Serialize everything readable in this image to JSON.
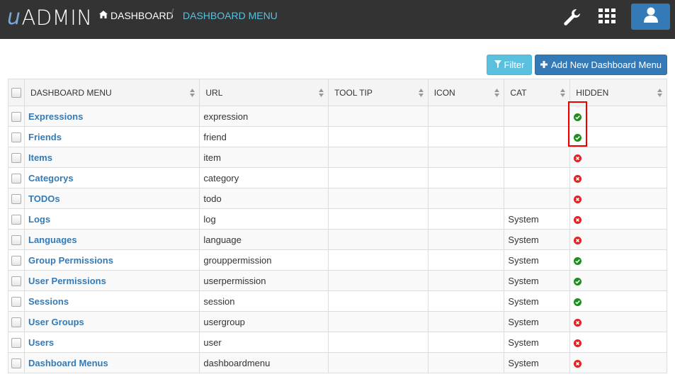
{
  "brand": {
    "prefix": "u",
    "name": "ADMIN"
  },
  "breadcrumb": {
    "home": "DASHBOARD",
    "separator": "/",
    "current": "DASHBOARD MENU"
  },
  "toolbar": {
    "filter_label": "Filter",
    "add_label": "Add New Dashboard Menu"
  },
  "table": {
    "columns": [
      "DASHBOARD MENU",
      "URL",
      "TOOL TIP",
      "ICON",
      "CAT",
      "HIDDEN"
    ],
    "rows": [
      {
        "name": "Expressions",
        "url": "expression",
        "tooltip": "",
        "icon": "",
        "cat": "",
        "hidden": true
      },
      {
        "name": "Friends",
        "url": "friend",
        "tooltip": "",
        "icon": "",
        "cat": "",
        "hidden": true
      },
      {
        "name": "Items",
        "url": "item",
        "tooltip": "",
        "icon": "",
        "cat": "",
        "hidden": false
      },
      {
        "name": "Categorys",
        "url": "category",
        "tooltip": "",
        "icon": "",
        "cat": "",
        "hidden": false
      },
      {
        "name": "TODOs",
        "url": "todo",
        "tooltip": "",
        "icon": "",
        "cat": "",
        "hidden": false
      },
      {
        "name": "Logs",
        "url": "log",
        "tooltip": "",
        "icon": "",
        "cat": "System",
        "hidden": false
      },
      {
        "name": "Languages",
        "url": "language",
        "tooltip": "",
        "icon": "",
        "cat": "System",
        "hidden": false
      },
      {
        "name": "Group Permissions",
        "url": "grouppermission",
        "tooltip": "",
        "icon": "",
        "cat": "System",
        "hidden": true
      },
      {
        "name": "User Permissions",
        "url": "userpermission",
        "tooltip": "",
        "icon": "",
        "cat": "System",
        "hidden": true
      },
      {
        "name": "Sessions",
        "url": "session",
        "tooltip": "",
        "icon": "",
        "cat": "System",
        "hidden": true
      },
      {
        "name": "User Groups",
        "url": "usergroup",
        "tooltip": "",
        "icon": "",
        "cat": "System",
        "hidden": false
      },
      {
        "name": "Users",
        "url": "user",
        "tooltip": "",
        "icon": "",
        "cat": "System",
        "hidden": false
      },
      {
        "name": "Dashboard Menus",
        "url": "dashboardmenu",
        "tooltip": "",
        "icon": "",
        "cat": "System",
        "hidden": false
      }
    ]
  },
  "icons": {
    "home": "home-icon",
    "wrench": "wrench-icon",
    "apps": "apps-grid-icon",
    "user": "user-icon",
    "filter": "filter-icon",
    "plus": "plus-icon",
    "check": "check-circle-icon",
    "cross": "x-circle-icon"
  },
  "colors": {
    "topbar": "#333333",
    "primary": "#337ab7",
    "info": "#5bc0de",
    "yes": "#1e8e1e",
    "no": "#e52222",
    "highlight": "#ee0000"
  }
}
